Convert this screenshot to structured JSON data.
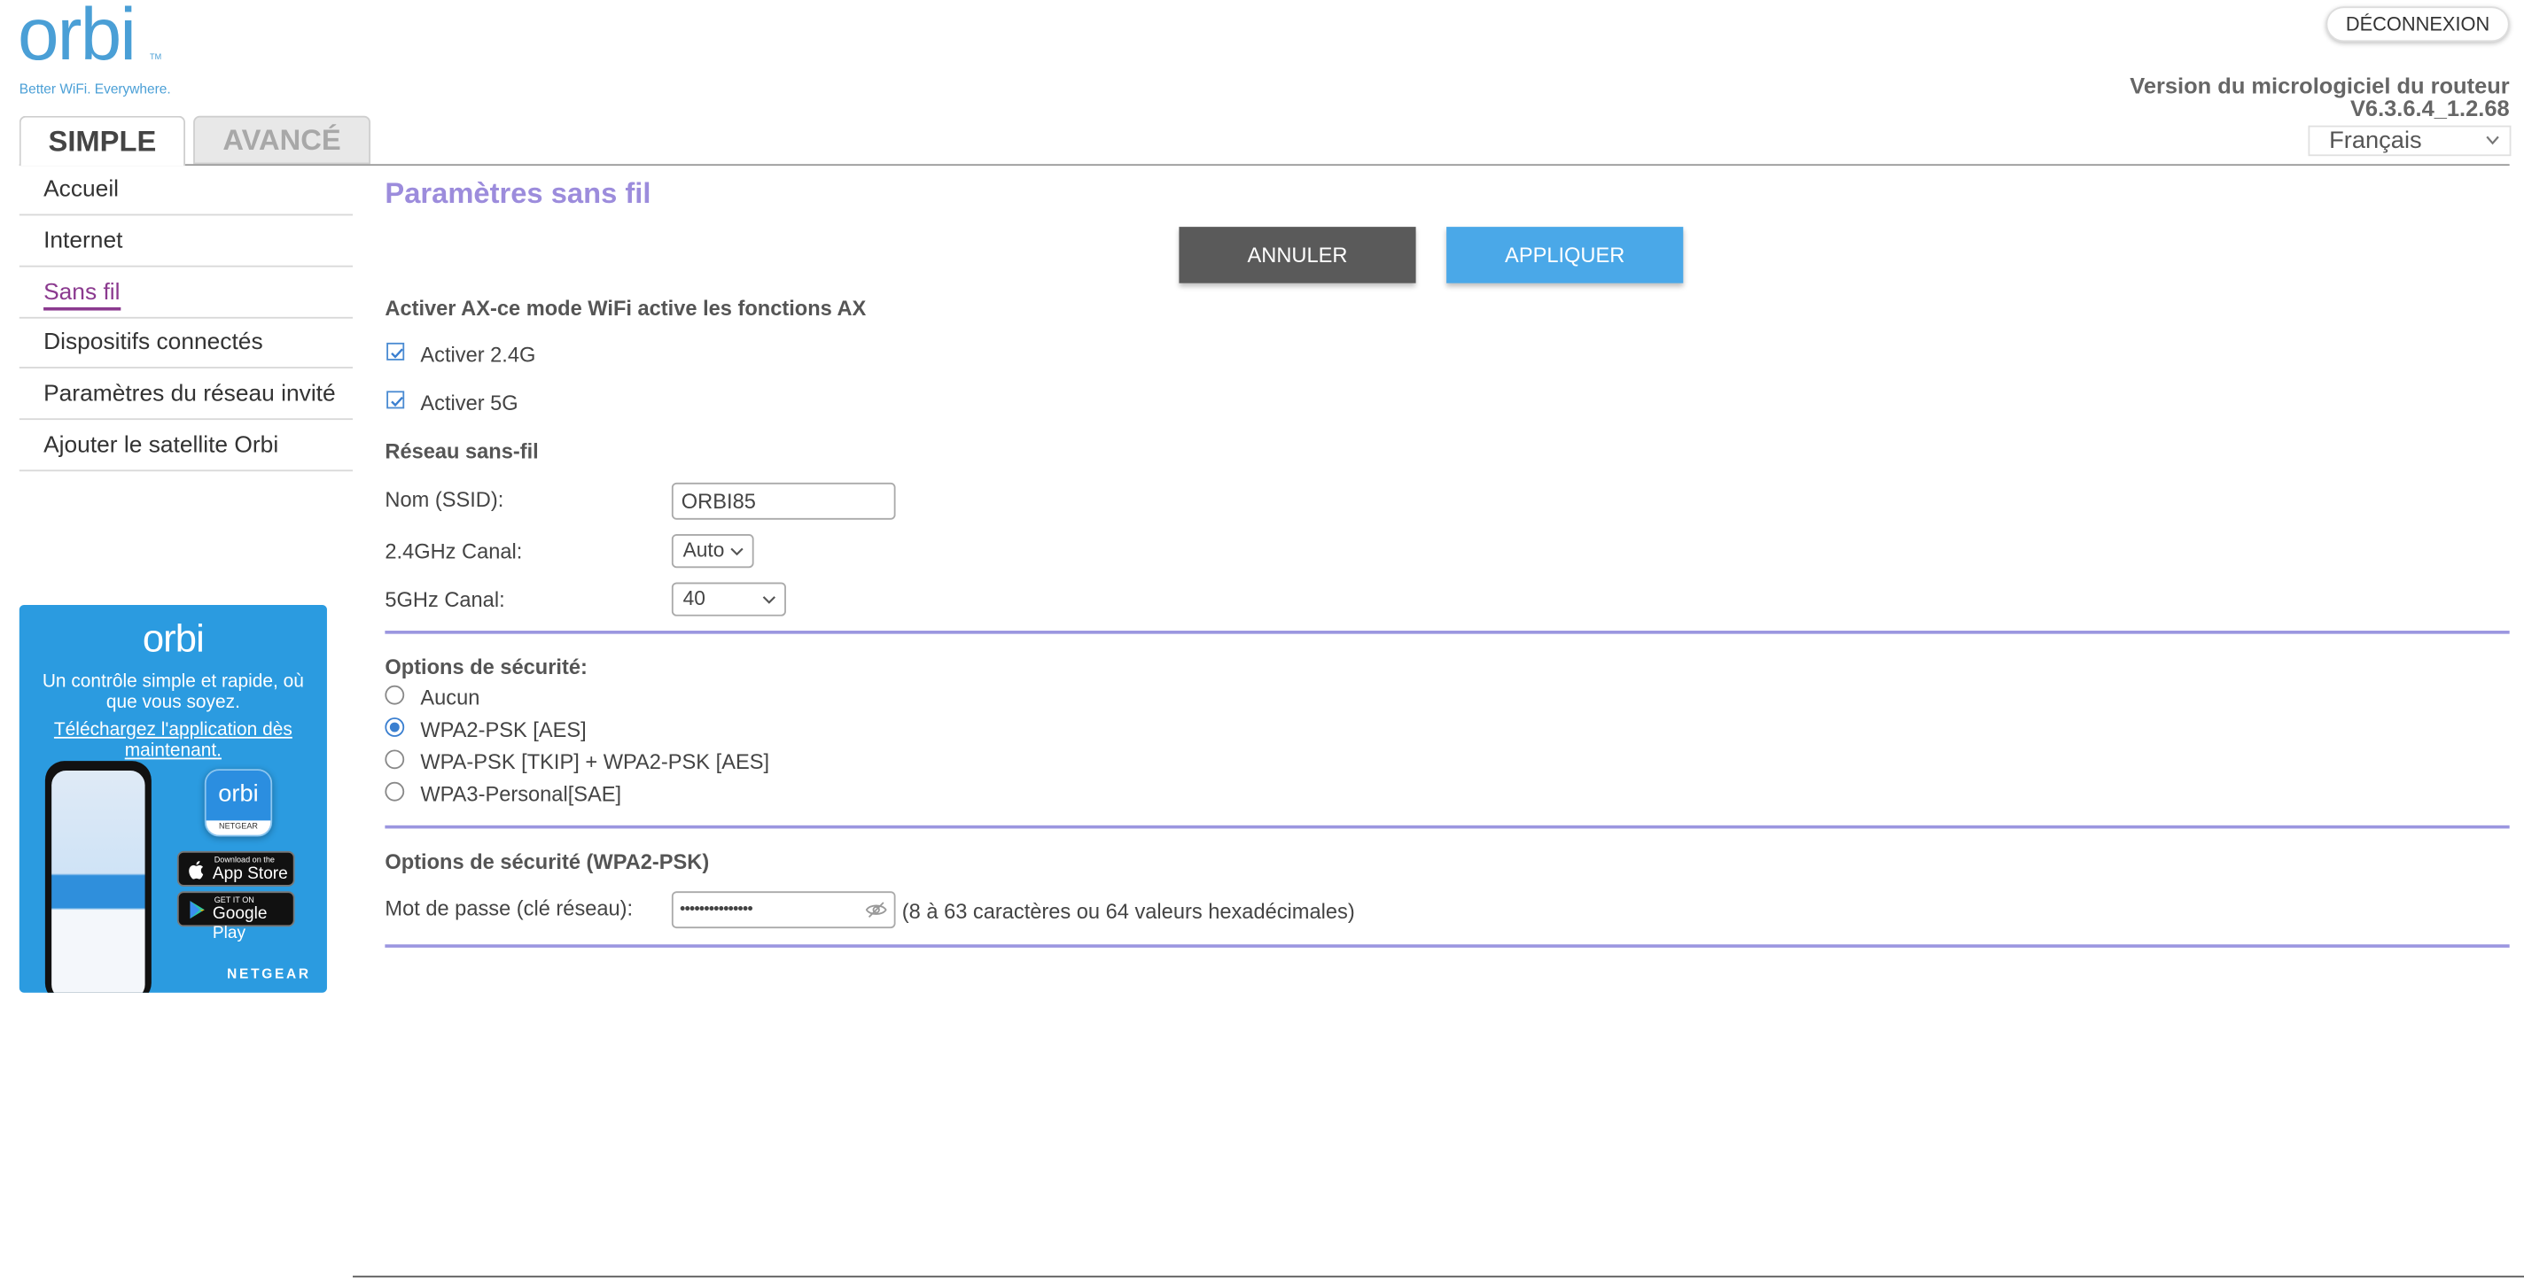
{
  "header": {
    "logo_word": "orbi",
    "logo_tm": "TM",
    "logo_tagline": "Better WiFi. Everywhere.",
    "logout_label": "DÉCONNEXION",
    "firmware_label": "Version du micrologiciel du routeur",
    "firmware_version": "V6.3.6.4_1.2.68",
    "language": "Français"
  },
  "tabs": [
    {
      "label": "SIMPLE",
      "active": true
    },
    {
      "label": "AVANCÉ",
      "active": false
    }
  ],
  "sidebar": {
    "items": [
      {
        "label": "Accueil"
      },
      {
        "label": "Internet"
      },
      {
        "label": "Sans fil"
      },
      {
        "label": "Dispositifs connectés"
      },
      {
        "label": "Paramètres du réseau invité"
      },
      {
        "label": "Ajouter le satellite Orbi"
      }
    ]
  },
  "promo": {
    "logo": "orbi",
    "text": "Un contrôle simple et rapide, où que vous soyez.",
    "link": "Téléchargez l'application dès maintenant.",
    "app_icon_label": "orbi",
    "app_icon_sub": "NETGEAR",
    "app_store_small": "Download on the",
    "app_store_big": "App Store",
    "google_play_small": "GET IT ON",
    "google_play_big": "Google Play",
    "brand": "NETGEAR"
  },
  "main": {
    "title": "Paramètres sans fil",
    "cancel_label": "ANNULER",
    "apply_label": "APPLIQUER",
    "ax_heading": "Activer AX-ce mode WiFi active les fonctions AX",
    "enable_24_label": "Activer 2.4G",
    "enable_24_checked": true,
    "enable_5_label": "Activer 5G",
    "enable_5_checked": true,
    "network_heading": "Réseau sans-fil",
    "ssid_label": "Nom (SSID):",
    "ssid_value": "ORBI85",
    "channel24_label": "2.4GHz Canal:",
    "channel24_value": "Auto",
    "channel5_label": "5GHz Canal:",
    "channel5_value": "40",
    "security_heading": "Options de sécurité:",
    "security_options": [
      {
        "label": "Aucun",
        "selected": false
      },
      {
        "label": "WPA2-PSK [AES]",
        "selected": true
      },
      {
        "label": "WPA-PSK [TKIP] + WPA2-PSK [AES]",
        "selected": false
      },
      {
        "label": "WPA3-Personal[SAE]",
        "selected": false
      }
    ],
    "wpa2_heading": "Options de sécurité (WPA2-PSK)",
    "password_label": "Mot de passe (clé réseau):",
    "password_masked": "•••••••••••••••",
    "password_hint": "(8 à 63 caractères ou 64 valeurs hexadécimales)"
  },
  "colors": {
    "accent_blue": "#4aa8e8",
    "title_purple": "#9c8cdc",
    "active_nav": "#8b3a8f",
    "cancel_gray": "#5a5a5a"
  }
}
